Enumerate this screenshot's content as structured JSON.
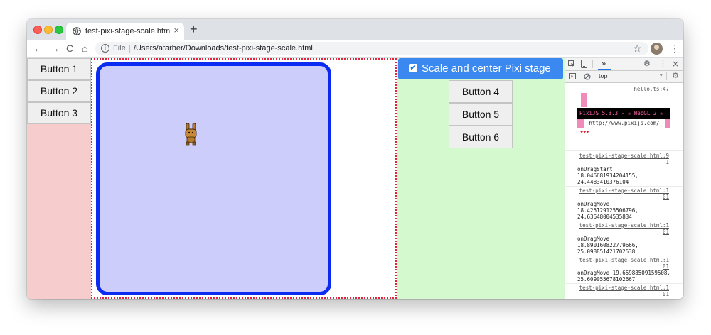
{
  "browser": {
    "tab_title": "test-pixi-stage-scale.html",
    "tab_close": "×",
    "new_tab": "+",
    "back": "←",
    "forward": "→",
    "reload": "C",
    "home": "⌂",
    "info_icon": "i",
    "file_label": "File",
    "url": "/Users/afarber/Downloads/test-pixi-stage-scale.html",
    "star": "☆",
    "menu": "⋮"
  },
  "page": {
    "left_buttons": [
      "Button 1",
      "Button 2",
      "Button 3"
    ],
    "scale_checkbox": "✔",
    "scale_button": "Scale and center Pixi stage",
    "right_buttons": [
      "Button 4",
      "Button 5",
      "Button 6"
    ],
    "colors": {
      "left_bg": "#f6cccc",
      "right_bg": "#d4f9cf",
      "stage_fill": "#cccdfb",
      "stage_border": "#0b2bf2",
      "scale_button": "#3a88f0"
    }
  },
  "devtools": {
    "more_tabs": "»",
    "settings": "⚙",
    "menu": "⋮",
    "close": "×",
    "context": "top",
    "context_arrow": "▾",
    "first_source": "hello.ts:47",
    "pixi_banner": "PixiJS 5.3.3 - ✰ WebGL 2 ✰",
    "pixi_url": "http://www.pixijs.com/",
    "hearts": "♥♥♥",
    "logs": [
      {
        "src1": "test-pixi-stage-scale.html:9",
        "src2": "1",
        "lines": [
          "onDragStart",
          "18.046681934204155,",
          "24.4483410376104"
        ]
      },
      {
        "src1": "test-pixi-stage-scale.html:1",
        "src2": "01",
        "lines": [
          "onDragMove",
          "18.425129125506796,",
          "24.63648004535834"
        ]
      },
      {
        "src1": "test-pixi-stage-scale.html:1",
        "src2": "01",
        "lines": [
          "onDragMove",
          "18.890160822779666,",
          "25.098851421702538"
        ]
      },
      {
        "src1": "test-pixi-stage-scale.html:1",
        "src2": "01",
        "lines": [
          "onDragMove 19.65988509159508,",
          "25.609055678102667"
        ]
      },
      {
        "src1": "test-pixi-stage-scale.html:1",
        "src2": "01",
        "lines": []
      }
    ]
  }
}
